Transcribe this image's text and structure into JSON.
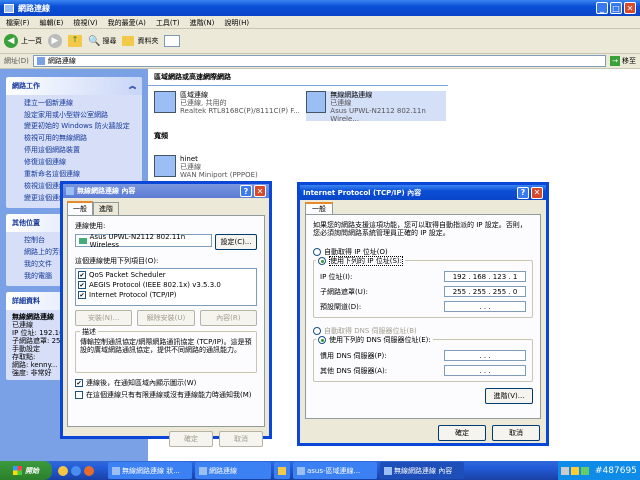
{
  "window": {
    "title": "網路連線"
  },
  "menu": [
    "檔案(F)",
    "編輯(E)",
    "檢視(V)",
    "我的最愛(A)",
    "工具(T)",
    "進階(N)",
    "說明(H)"
  ],
  "toolbar": {
    "back": "上一頁",
    "search": "搜尋",
    "folders": "資料夾"
  },
  "address": {
    "label": "網址(D)",
    "value": "網路連線",
    "go": "移至"
  },
  "sidebar": {
    "tasks_title": "網路工作",
    "tasks": [
      "建立一個新連線",
      "設定家用或小型辦公室網路",
      "變更初始的 Windows 防火牆設定",
      "檢視可用的無線網路",
      "停用這個網路裝置",
      "修復這個連線",
      "重新命名這個連線",
      "檢視這個連線的狀態",
      "變更這個連線的設定"
    ],
    "other_title": "其他位置",
    "other": [
      "控制台",
      "網路上的芳鄰",
      "我的文件",
      "我的電腦"
    ],
    "detail_title": "詳細資料",
    "detail": [
      "無線網路連線",
      "已連線",
      "IP 位址: 192.168.123.1",
      "子網路遮罩: 255.255.255.0",
      "手動設定",
      "存取點:",
      "網路: kenny...",
      "強度: 非常好"
    ]
  },
  "main": {
    "lan_header": "區域網路或高速網際網路",
    "lan1": {
      "name": "區域連線",
      "status": "已連線, 共用的",
      "device": "Realtek RTL8168C(P)/8111C(P) F..."
    },
    "lan2": {
      "name": "無線網路連線",
      "status": "已連線",
      "device": "Asus UPWL-N2112 802.11n Wirele..."
    },
    "broadband_header": "寬頻",
    "bb1": {
      "name": "hinet",
      "status": "已連線",
      "device": "WAN Miniport (PPPOE)"
    }
  },
  "props": {
    "title": "無線網路連線 內容",
    "tabs": [
      "一般",
      "進階"
    ],
    "connect_using": "連線使用:",
    "adapter": "Asus UPWL-N2112 802.11n Wireless",
    "config": "設定(C)...",
    "items_label": "這個連線使用下列項目(O):",
    "items": [
      "QoS Packet Scheduler",
      "AEGIS Protocol (IEEE 802.1x) v3.5.3.0",
      "Internet Protocol (TCP/IP)"
    ],
    "install": "安裝(N)...",
    "uninstall": "解除安裝(U)",
    "properties": "內容(R)",
    "desc_title": "描述",
    "desc": "傳輸控制通訊協定/網際網路通訊協定 (TCP/IP)。這是預設的廣域網路通訊協定，提供不同網路的通訊能力。",
    "show_icon": "連線後，在通知區域內顯示圖示(W)",
    "notify": "在這個連線只有有限連線或沒有連線能力時通知我(M)",
    "ok": "確定",
    "cancel": "取消"
  },
  "tcpip": {
    "title": "Internet Protocol (TCP/IP) 內容",
    "tab": "一般",
    "intro": "如果您的網路支援這項功能，您可以取得自動指派的 IP 設定。否則，您必須詢問網路系統管理員正確的 IP 設定。",
    "auto_ip": "自動取得 IP 位址(O)",
    "use_ip": "使用下列的 IP 位址(S):",
    "ip_label": "IP 位址(I):",
    "ip": "192 . 168 . 123 . 1",
    "mask_label": "子網路遮罩(U):",
    "mask": "255 . 255 . 255 . 0",
    "gw_label": "預設閘道(D):",
    "gw": ". . .",
    "auto_dns": "自動取得 DNS 伺服器位址(B)",
    "use_dns": "使用下列的 DNS 伺服器位址(E):",
    "dns1_label": "慣用 DNS 伺服器(P):",
    "dns1": ". . .",
    "dns2_label": "其他 DNS 伺服器(A):",
    "dns2": ". . .",
    "advanced": "進階(V)...",
    "ok": "確定",
    "cancel": "取消"
  },
  "taskbar": {
    "start": "開始",
    "tasks": [
      "無線網路連線 狀...",
      "網路連線",
      "",
      "asus-區域連線...",
      "無線網路連線 內容"
    ],
    "watermark": "#487695"
  }
}
